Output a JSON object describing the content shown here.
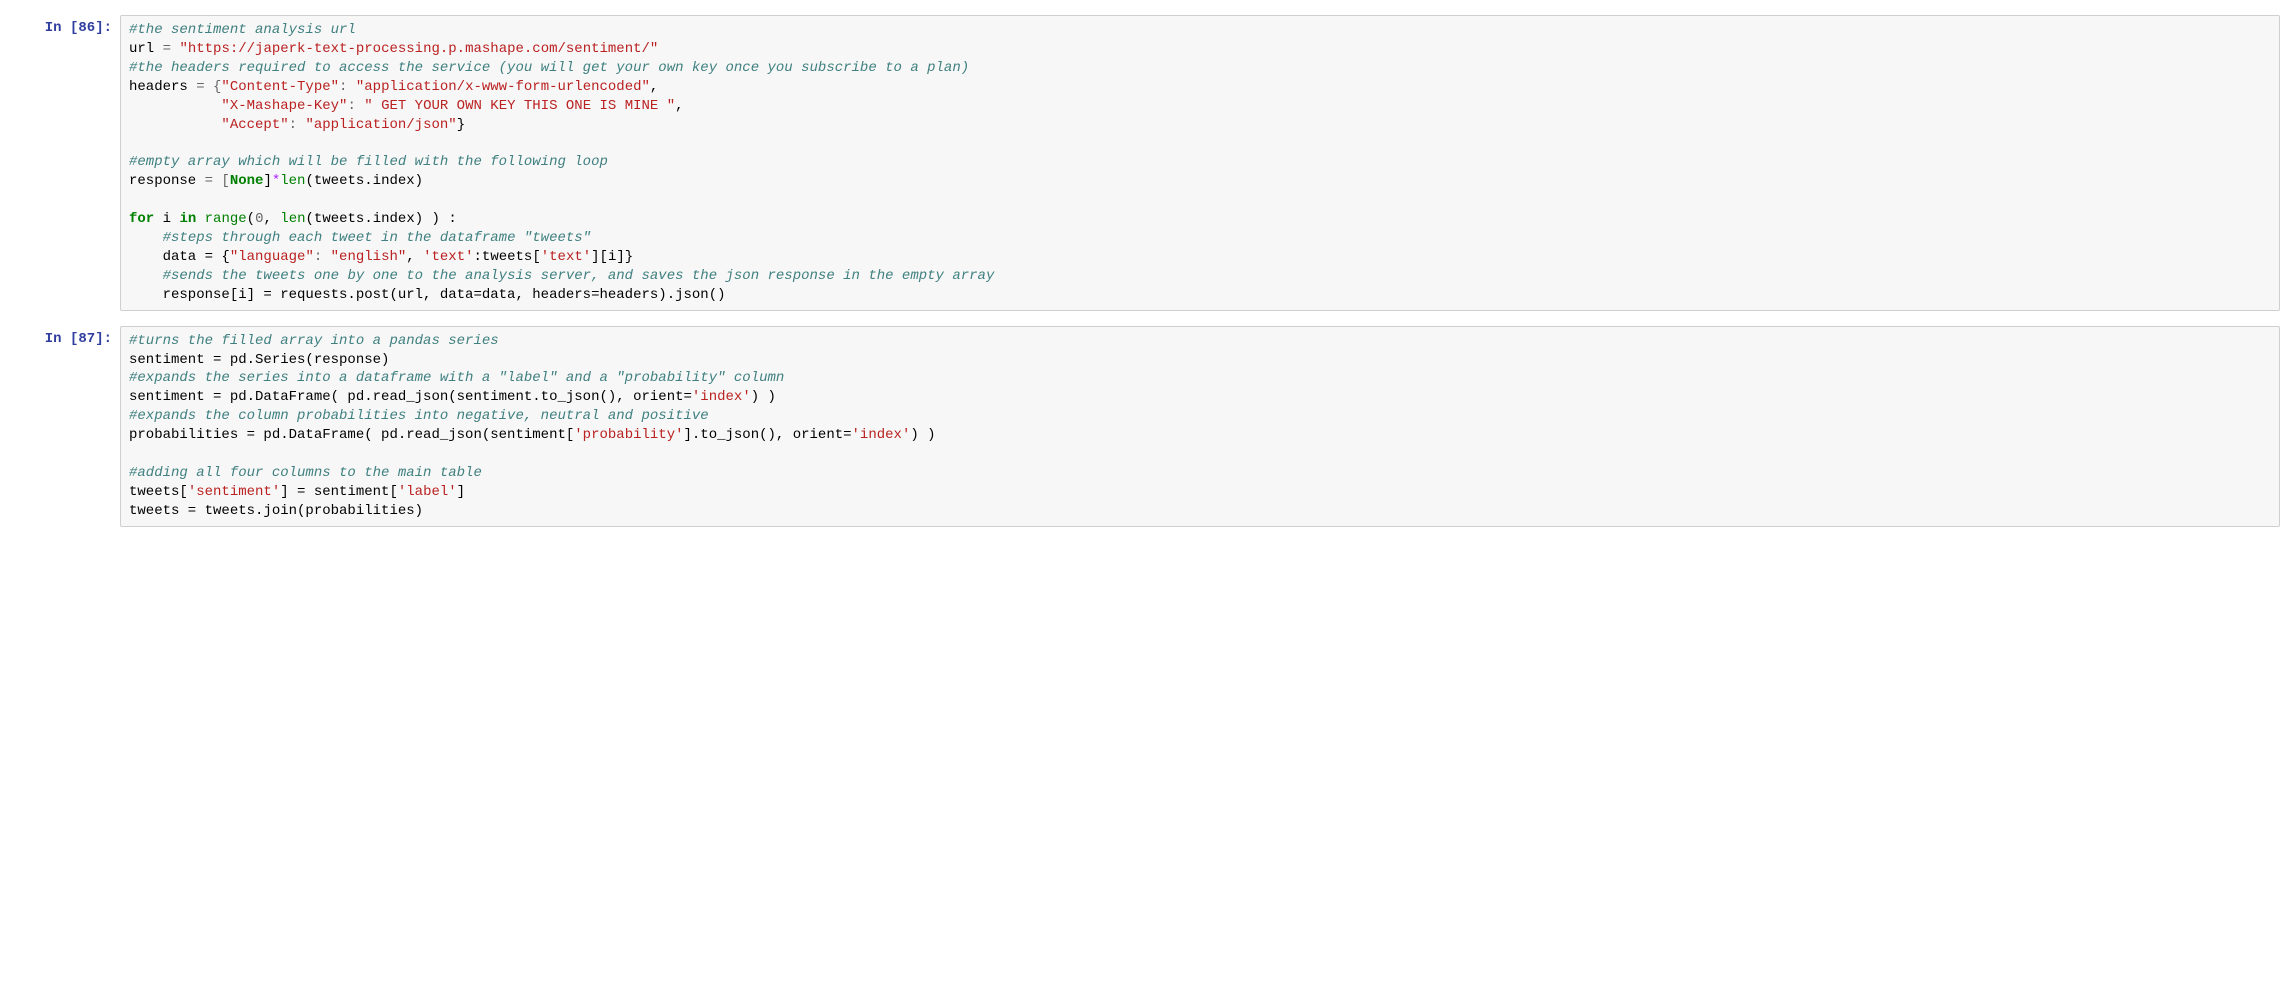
{
  "cells": [
    {
      "prompt_label": "In [86]:",
      "code": {
        "l1_comment": "#the sentiment analysis url",
        "l2_name": "url",
        "l2_eq": " = ",
        "l2_str": "\"https://japerk-text-processing.p.mashape.com/sentiment/\"",
        "l3_comment": "#the headers required to access the service (you will get your own key once you subscribe to a plan)",
        "l4_name": "headers",
        "l4_eq": " = {",
        "l4_k1": "\"Content-Type\"",
        "l4_colon": ": ",
        "l4_v1": "\"application/x-www-form-urlencoded\"",
        "l4_comma": ",",
        "l5_indent": "           ",
        "l5_k": "\"X-Mashape-Key\"",
        "l5_colon": ": ",
        "l5_v": "\" GET YOUR OWN KEY THIS ONE IS MINE \"",
        "l5_comma": ",",
        "l6_indent": "           ",
        "l6_k": "\"Accept\"",
        "l6_colon": ": ",
        "l6_v": "\"application/json\"",
        "l6_close": "}",
        "l8_comment": "#empty array which will be filled with the following loop",
        "l9_name": "response",
        "l9_eq": " = [",
        "l9_none": "None",
        "l9_close": "]",
        "l9_star": "*",
        "l9_len": "len",
        "l9_paren": "(tweets.index)",
        "l11_for": "for",
        "l11_i": " i ",
        "l11_in": "in",
        "l11_range": " range",
        "l11_open": "(",
        "l11_zero": "0",
        "l11_comma": ", ",
        "l11_len": "len",
        "l11_args": "(tweets.index) ) :",
        "l12_indent": "    ",
        "l12_comment": "#steps through each tweet in the dataframe \"tweets\"",
        "l13_indent": "    data = {",
        "l13_k1": "\"language\"",
        "l13_colon1": ": ",
        "l13_v1": "\"english\"",
        "l13_comma": ", ",
        "l13_k2": "'text'",
        "l13_colon2": ":tweets[",
        "l13_v2": "'text'",
        "l13_close": "][i]}",
        "l14_indent": "    ",
        "l14_comment": "#sends the tweets one by one to the analysis server, and saves the json response in the empty array",
        "l15_indent": "    response[i] = requests.post(url, data=data, headers=headers).json()"
      }
    },
    {
      "prompt_label": "In [87]:",
      "code": {
        "l1_comment": "#turns the filled array into a pandas series",
        "l2": "sentiment = pd.Series(response)",
        "l3_comment": "#expands the series into a dataframe with a \"label\" and a \"probability\" column",
        "l4_a": "sentiment = pd.DataFrame( pd.read_json(sentiment.to_json(), orient=",
        "l4_s": "'index'",
        "l4_b": ") )",
        "l5_comment": "#expands the column probabilities into negative, neutral and positive",
        "l6_a": "probabilities = pd.DataFrame( pd.read_json(sentiment[",
        "l6_s1": "'probability'",
        "l6_b": "].to_json(), orient=",
        "l6_s2": "'index'",
        "l6_c": ") )",
        "l8_comment": "#adding all four columns to the main table",
        "l9_a": "tweets[",
        "l9_s1": "'sentiment'",
        "l9_b": "] = sentiment[",
        "l9_s2": "'label'",
        "l9_c": "]",
        "l10": "tweets = tweets.join(probabilities)"
      }
    }
  ]
}
